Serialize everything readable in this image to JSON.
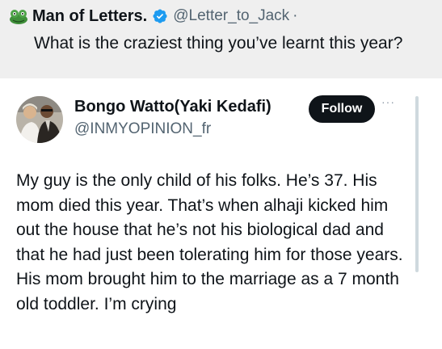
{
  "quoted_tweet": {
    "author_name": "Man of Letters.",
    "author_handle": "@Letter_to_Jack",
    "separator": "·",
    "verified": true,
    "text": "What is the craziest thing you’ve learnt this year?"
  },
  "tweet": {
    "author_name": "Bongo Watto(Yaki Kedafi)",
    "author_handle": "@INMYOPINION_fr",
    "follow_label": "Follow",
    "more_label": "···",
    "text": "My guy is the only child of his folks. He’s 37. His mom died this year. That’s when alhaji kicked him out the house that he’s not his biological dad and that he had just been tolerating him for those years. His mom brought him to the marriage as a 7 month old toddler. I’m crying"
  },
  "colors": {
    "verified_blue": "#1d9bf0",
    "follow_bg": "#0f1419",
    "handle_gray": "#536471",
    "quoted_bg": "#efefef"
  }
}
